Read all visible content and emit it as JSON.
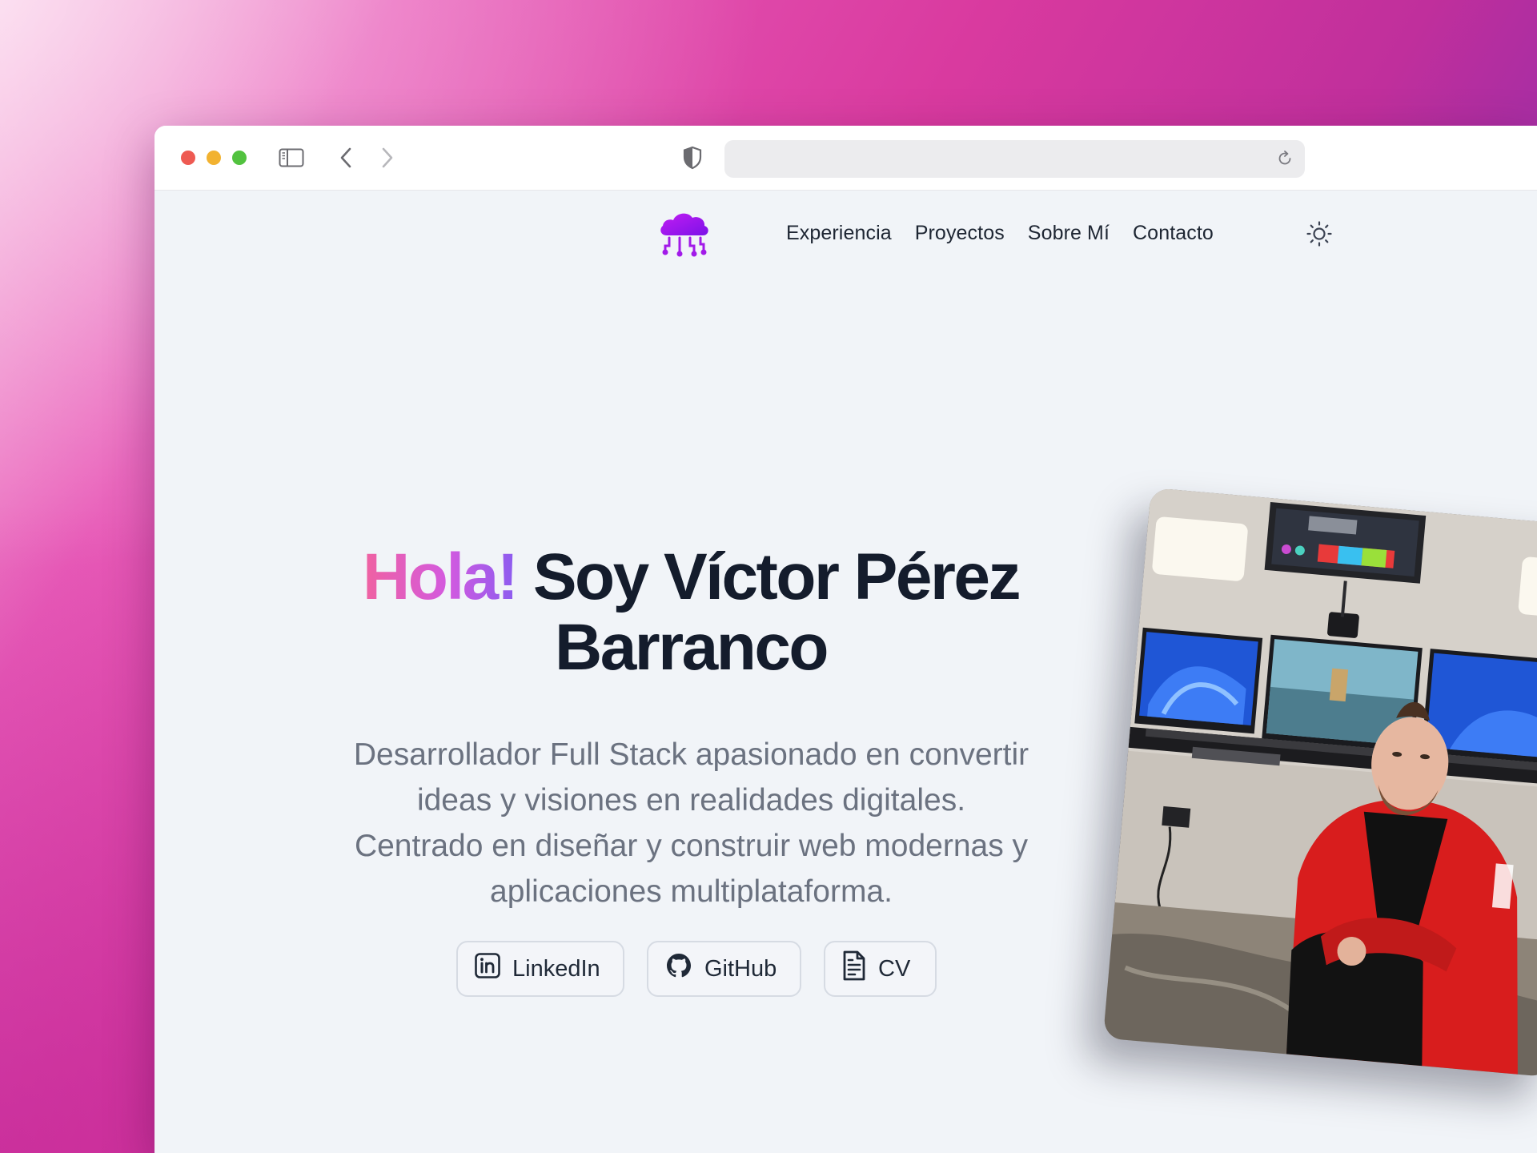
{
  "browser": {
    "address_value": "",
    "icons": [
      "sidebar-icon",
      "back-icon",
      "forward-icon",
      "shield-icon",
      "reload-icon"
    ]
  },
  "site": {
    "logo_icon": "cloud-circuit-icon",
    "nav": [
      "Experiencia",
      "Proyectos",
      "Sobre Mí",
      "Contacto"
    ],
    "theme_icon": "sun-icon"
  },
  "hero": {
    "greeting": "Hola!",
    "name": "Soy Víctor Pérez Barranco",
    "description": "Desarrollador Full Stack apasionado en convertir ideas y visiones en realidades digitales. Centrado en diseñar y construir web modernas y aplicaciones multiplataforma.",
    "buttons": [
      {
        "label": "LinkedIn",
        "icon": "linkedin-icon"
      },
      {
        "label": "GitHub",
        "icon": "github-icon"
      },
      {
        "label": "CV",
        "icon": "document-icon"
      }
    ]
  },
  "colors": {
    "gradient_start": "#f062a0",
    "gradient_end": "#8a5cf0",
    "title": "#141c2c",
    "body_text": "#6b7280"
  }
}
